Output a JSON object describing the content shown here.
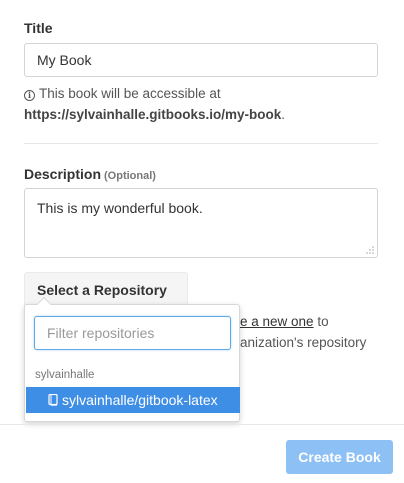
{
  "form": {
    "title_label": "Title",
    "title_value": "My Book",
    "help_prefix": "This book will be accessible at",
    "help_url": "https://sylvainhalle.gitbooks.io/my-book",
    "help_suffix": ".",
    "description_label": "Description",
    "description_optional": "(Optional)",
    "description_value": "This is my wonderful book.",
    "repo_button_label": "Select a Repository",
    "behind_text_line1_link": "e a new one",
    "behind_text_line1_suffix": " to",
    "behind_text_line2": "anization's repository"
  },
  "dropdown": {
    "filter_placeholder": "Filter repositories",
    "group_label": "sylvainhalle",
    "items": [
      {
        "label": "sylvainhalle/gitbook-latex",
        "selected": true
      }
    ]
  },
  "footer": {
    "create_label": "Create Book"
  },
  "colors": {
    "accent": "#3f8ee6",
    "create_button": "#8dc0f5",
    "filter_border": "#5fa8e6"
  }
}
